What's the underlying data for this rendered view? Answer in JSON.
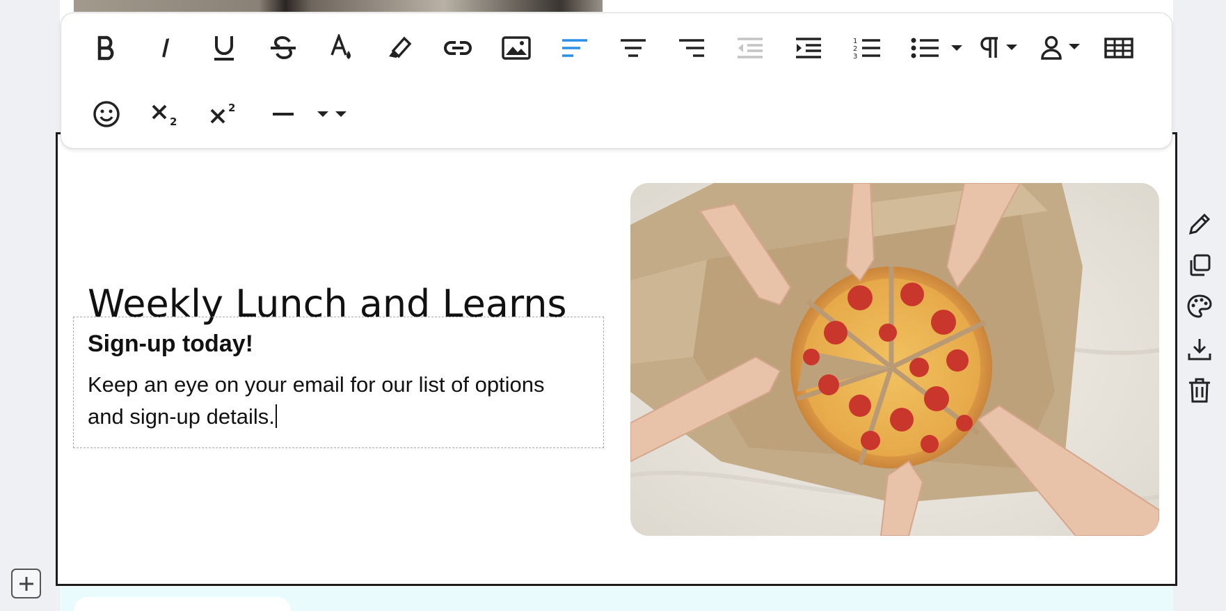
{
  "toolbar": {
    "row1": [
      {
        "name": "bold-button",
        "icon": "bold-icon"
      },
      {
        "name": "italic-button",
        "icon": "italic-icon"
      },
      {
        "name": "underline-button",
        "icon": "underline-icon"
      },
      {
        "name": "strikethrough-button",
        "icon": "strikethrough-icon"
      },
      {
        "name": "text-color-button",
        "icon": "text-color-icon"
      },
      {
        "name": "highlight-button",
        "icon": "highlighter-icon"
      },
      {
        "name": "link-button",
        "icon": "link-icon"
      },
      {
        "name": "image-button",
        "icon": "image-icon"
      },
      {
        "name": "align-left-button",
        "icon": "align-left-icon",
        "active": true
      },
      {
        "name": "align-center-button",
        "icon": "align-center-icon"
      },
      {
        "name": "align-right-button",
        "icon": "align-right-icon"
      },
      {
        "name": "outdent-button",
        "icon": "outdent-icon",
        "disabled": true
      },
      {
        "name": "indent-button",
        "icon": "indent-icon"
      },
      {
        "name": "numbered-list-button",
        "icon": "numbered-list-icon"
      },
      {
        "name": "bulleted-list-button",
        "icon": "bulleted-list-icon"
      },
      {
        "name": "paragraph-style-button",
        "icon": "paragraph-icon"
      },
      {
        "name": "personalize-button",
        "icon": "person-icon"
      },
      {
        "name": "table-button",
        "icon": "table-icon"
      }
    ],
    "row2": [
      {
        "name": "emoji-button",
        "icon": "emoji-icon"
      },
      {
        "name": "subscript-button",
        "icon": "subscript-icon"
      },
      {
        "name": "superscript-button",
        "icon": "superscript-icon"
      },
      {
        "name": "horizontal-rule-button",
        "icon": "horizontal-rule-icon"
      },
      {
        "name": "more-options-button",
        "icon": "chevron-down-icon"
      }
    ],
    "active_color": "#2b8fe8",
    "disabled_color": "#c4c4c4"
  },
  "content": {
    "heading": "Weekly Lunch and Learns",
    "subheading": "Sign-up today!",
    "body": "Keep an eye on your email for our list of options and sign-up details."
  },
  "side_actions": [
    {
      "name": "edit-section-button",
      "icon": "pencil-icon"
    },
    {
      "name": "duplicate-section-button",
      "icon": "copy-icon"
    },
    {
      "name": "section-style-button",
      "icon": "palette-icon"
    },
    {
      "name": "download-section-button",
      "icon": "download-icon"
    },
    {
      "name": "delete-section-button",
      "icon": "trash-icon"
    }
  ],
  "add_section": {
    "icon": "plus-icon"
  },
  "image": {
    "subject": "hands-taking-pepperoni-pizza-slices"
  }
}
